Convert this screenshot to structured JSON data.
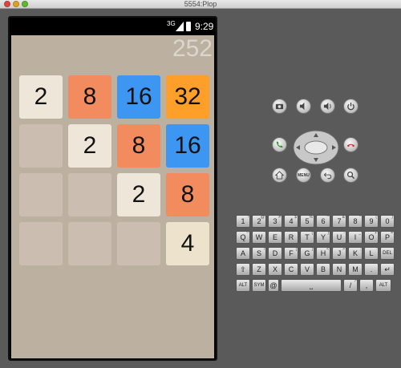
{
  "window": {
    "title": "5554:Plop"
  },
  "statusbar": {
    "network": "3G",
    "time": "9:29"
  },
  "game": {
    "score": "252",
    "tiles": [
      {
        "r": 0,
        "c": 0,
        "v": "2",
        "color": "#efe6da"
      },
      {
        "r": 0,
        "c": 1,
        "v": "8",
        "color": "#f28b5e"
      },
      {
        "r": 0,
        "c": 2,
        "v": "16",
        "color": "#3d96f2"
      },
      {
        "r": 0,
        "c": 3,
        "v": "32",
        "color": "#fe9f2a"
      },
      {
        "r": 1,
        "c": 0,
        "v": "",
        "color": "#cbbeb0"
      },
      {
        "r": 1,
        "c": 1,
        "v": "2",
        "color": "#efe6da"
      },
      {
        "r": 1,
        "c": 2,
        "v": "8",
        "color": "#f28b5e"
      },
      {
        "r": 1,
        "c": 3,
        "v": "16",
        "color": "#3d96f2"
      },
      {
        "r": 2,
        "c": 0,
        "v": "",
        "color": "#cbbeb0"
      },
      {
        "r": 2,
        "c": 1,
        "v": "",
        "color": "#cbbeb0"
      },
      {
        "r": 2,
        "c": 2,
        "v": "2",
        "color": "#efe6da"
      },
      {
        "r": 2,
        "c": 3,
        "v": "8",
        "color": "#f28b5e"
      },
      {
        "r": 3,
        "c": 0,
        "v": "",
        "color": "#cbbeb0"
      },
      {
        "r": 3,
        "c": 1,
        "v": "",
        "color": "#cbbeb0"
      },
      {
        "r": 3,
        "c": 2,
        "v": "",
        "color": "#cbbeb0"
      },
      {
        "r": 3,
        "c": 3,
        "v": "4",
        "color": "#ede2cb"
      }
    ]
  },
  "controls": {
    "menu_label": "MENU",
    "buttons": [
      "camera-icon",
      "volume-down-icon",
      "volume-up-icon",
      "power-icon",
      "call-icon",
      "end-call-icon",
      "home-icon",
      "back-icon",
      "search-icon"
    ]
  },
  "keyboard": {
    "rows": [
      [
        {
          "k": "1",
          "a": "!"
        },
        {
          "k": "2",
          "a": "@"
        },
        {
          "k": "3",
          "a": "#"
        },
        {
          "k": "4",
          "a": "$"
        },
        {
          "k": "5",
          "a": "%"
        },
        {
          "k": "6",
          "a": "^"
        },
        {
          "k": "7",
          "a": "&"
        },
        {
          "k": "8",
          "a": "*"
        },
        {
          "k": "9",
          "a": "("
        },
        {
          "k": "0",
          "a": ")"
        }
      ],
      [
        {
          "k": "Q",
          "a": "~"
        },
        {
          "k": "W",
          "a": "\""
        },
        {
          "k": "E",
          "a": "'"
        },
        {
          "k": "R",
          "a": ""
        },
        {
          "k": "T",
          "a": "{"
        },
        {
          "k": "Y",
          "a": "}"
        },
        {
          "k": "U",
          "a": "-"
        },
        {
          "k": "I",
          "a": "_"
        },
        {
          "k": "O",
          "a": "+"
        },
        {
          "k": "P",
          "a": "="
        }
      ],
      [
        {
          "k": "A",
          "a": ""
        },
        {
          "k": "S",
          "a": "\\"
        },
        {
          "k": "D",
          "a": ""
        },
        {
          "k": "F",
          "a": "["
        },
        {
          "k": "G",
          "a": "]"
        },
        {
          "k": "H",
          "a": "<"
        },
        {
          "k": "J",
          "a": ">"
        },
        {
          "k": "K",
          "a": ";"
        },
        {
          "k": "L",
          "a": ":"
        },
        {
          "k": "DEL",
          "a": ""
        }
      ],
      [
        {
          "k": "⇧",
          "a": ""
        },
        {
          "k": "Z",
          "a": ""
        },
        {
          "k": "X",
          "a": ""
        },
        {
          "k": "C",
          "a": ""
        },
        {
          "k": "V",
          "a": ""
        },
        {
          "k": "B",
          "a": ""
        },
        {
          "k": "N",
          "a": ""
        },
        {
          "k": "M",
          "a": ""
        },
        {
          "k": ".",
          "a": ""
        },
        {
          "k": "↵",
          "a": ""
        }
      ],
      [
        {
          "k": "ALT",
          "a": ""
        },
        {
          "k": "SYM",
          "a": ""
        },
        {
          "k": "@",
          "a": ""
        },
        {
          "k": "⎵",
          "a": ""
        },
        {
          "k": "/",
          "a": "?"
        },
        {
          "k": ",",
          "a": ""
        },
        {
          "k": "ALT",
          "a": ""
        }
      ]
    ]
  }
}
